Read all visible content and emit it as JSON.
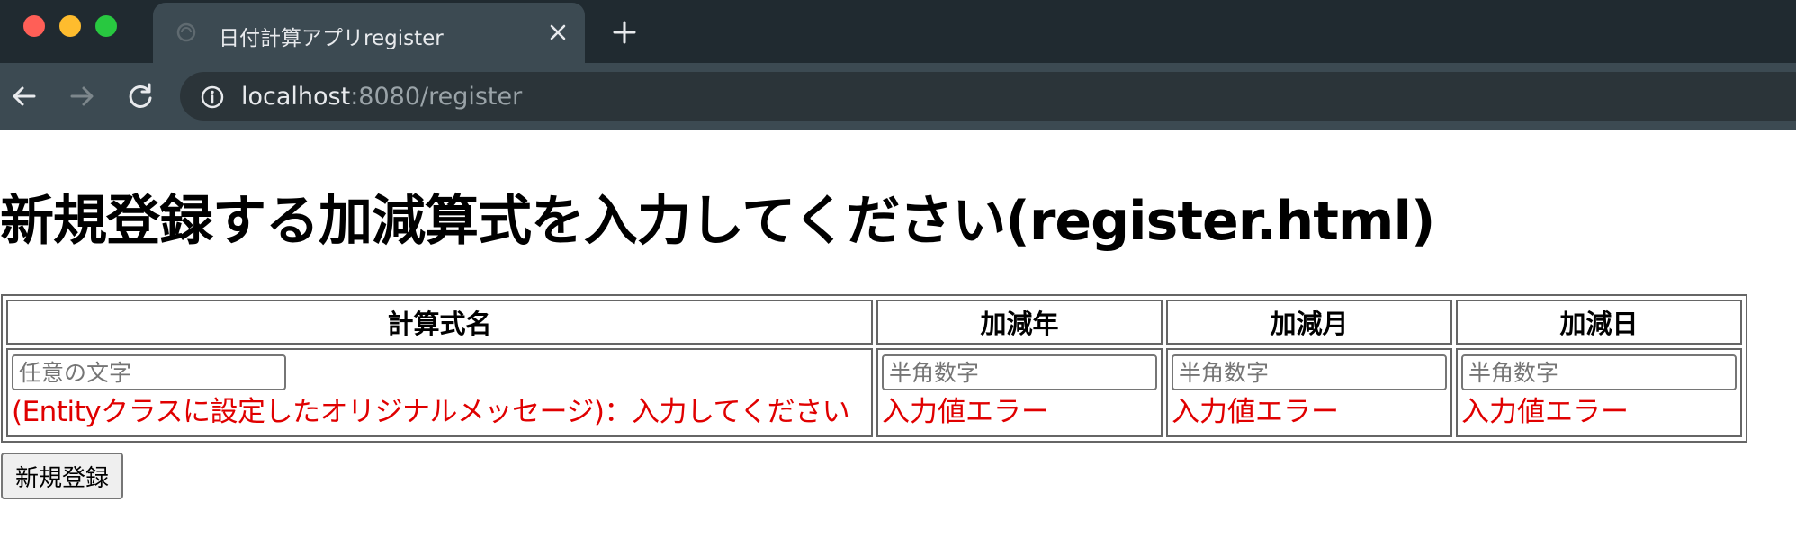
{
  "browser": {
    "tab_title": "日付計算アプリregister",
    "url_host": "localhost",
    "url_path": ":8080/register"
  },
  "page": {
    "heading": "新規登録する加減算式を入力してください(register.html)",
    "table": {
      "headers": [
        "計算式名",
        "加減年",
        "加減月",
        "加減日"
      ],
      "placeholders": [
        "任意の文字",
        "半角数字",
        "半角数字",
        "半角数字"
      ],
      "errors": [
        "(Entityクラスに設定したオリジナルメッセージ)：入力してください",
        "入力値エラー",
        "入力値エラー",
        "入力値エラー"
      ]
    },
    "submit_label": "新規登録"
  },
  "colors": {
    "tabbar_bg": "#202a30",
    "toolbar_bg": "#3c4a52",
    "error_text": "#e00000"
  },
  "icons": [
    "tab-favicon",
    "close-icon",
    "plus-icon",
    "back-arrow-icon",
    "forward-arrow-icon",
    "reload-icon",
    "info-icon"
  ]
}
